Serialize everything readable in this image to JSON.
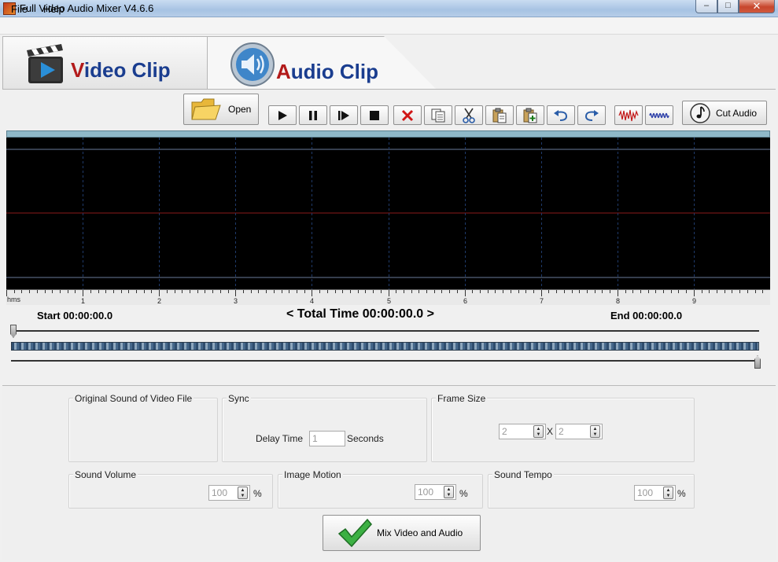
{
  "window": {
    "title": "Full Video Audio Mixer V4.6.6",
    "min_label": "–",
    "max_label": "□",
    "close_label": "✕"
  },
  "menu": {
    "items": [
      "File",
      "Help"
    ]
  },
  "tabs": {
    "video": {
      "first": "V",
      "rest": "ideo Clip"
    },
    "audio": {
      "first": "A",
      "rest": "udio Clip"
    }
  },
  "toolbar": {
    "open_label": "Open",
    "cut_audio_label": "Cut Audio",
    "buttons": [
      "play-icon",
      "pause-icon",
      "step-play-icon",
      "stop-icon",
      "delete-icon",
      "copy-icon",
      "cut-icon",
      "paste-icon",
      "paste-new-icon",
      "undo-icon",
      "redo-icon",
      "noise-wave-icon",
      "tone-wave-icon"
    ]
  },
  "ruler": {
    "unit": "hms",
    "ticks": [
      "1",
      "2",
      "3",
      "4",
      "5",
      "6",
      "7",
      "8",
      "9"
    ]
  },
  "times": {
    "start": "Start 00:00:00.0",
    "total": "< Total Time 00:00:00.0 >",
    "end": "End 00:00:00.0"
  },
  "settings": {
    "original_sound_title": "Original Sound of Video File",
    "sync_title": "Sync",
    "delay_label": "Delay Time",
    "delay_value": "1",
    "seconds_label": "Seconds",
    "frame_size_title": "Frame Size",
    "frame_w": "2",
    "frame_x": "X",
    "frame_h": "2",
    "sound_volume_title": "Sound Volume",
    "sound_volume_value": "100",
    "image_motion_title": "Image Motion",
    "image_motion_value": "100",
    "sound_tempo_title": "Sound Tempo",
    "sound_tempo_value": "100",
    "percent": "%"
  },
  "mix_button_label": "Mix Video and Audio",
  "colors": {
    "wave_bg": "#000000",
    "wave_center": "#8b1a1a",
    "accent_blue": "#1a3d8f",
    "accent_red": "#b21a1a"
  }
}
